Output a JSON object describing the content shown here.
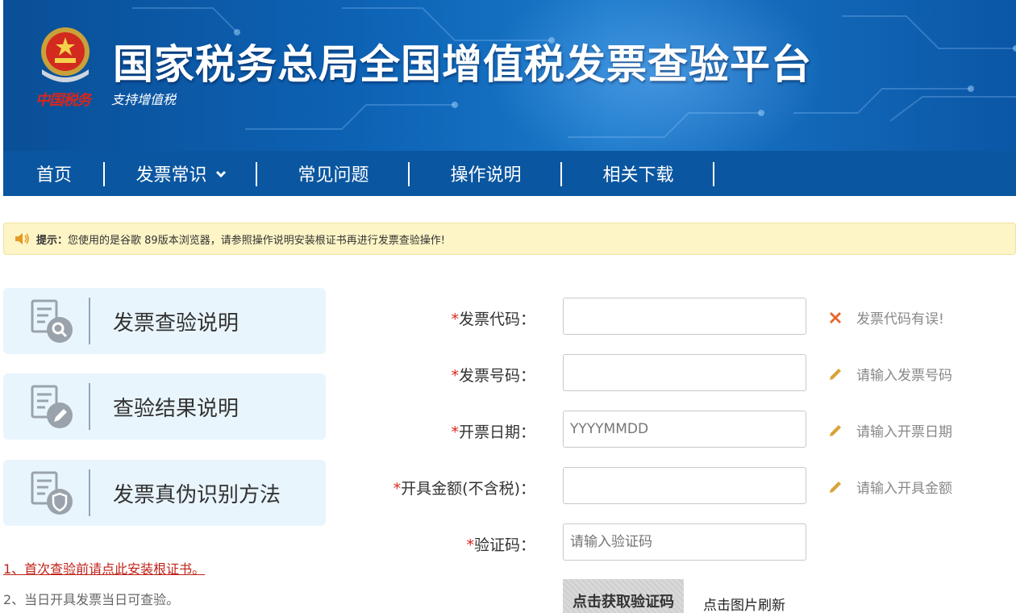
{
  "header": {
    "title": "国家税务总局全国增值税发票查验平台",
    "subtitle": "支持增值税",
    "brand_sign": "中国税务"
  },
  "nav": {
    "items": [
      {
        "label": "首页"
      },
      {
        "label": "发票常识",
        "dropdown": true
      },
      {
        "label": "常见问题"
      },
      {
        "label": "操作说明"
      },
      {
        "label": "相关下载"
      }
    ]
  },
  "tip": {
    "label": "提示：",
    "text": "您使用的是谷歌 89版本浏览器，请参照操作说明安装根证书再进行发票查验操作!"
  },
  "side_cards": [
    {
      "label": "发票查验说明",
      "icon": "doc-search-icon"
    },
    {
      "label": "查验结果说明",
      "icon": "doc-edit-icon"
    },
    {
      "label": "发票真伪识别方法",
      "icon": "doc-shield-icon"
    }
  ],
  "notes": [
    {
      "text": "1、首次查验前请点此安装根证书。"
    },
    {
      "text": "2、当日开具发票当日可查验。"
    }
  ],
  "form": {
    "required_mark": "*",
    "fields": [
      {
        "label": "发票代码：",
        "value": "",
        "placeholder": "",
        "hint": "发票代码有误!",
        "hint_icon": "error-x-icon"
      },
      {
        "label": "发票号码：",
        "value": "",
        "placeholder": "",
        "hint": "请输入发票号码",
        "hint_icon": "pencil-icon"
      },
      {
        "label": "开票日期：",
        "value": "",
        "placeholder": "YYYYMMDD",
        "hint": "请输入开票日期",
        "hint_icon": "pencil-icon"
      },
      {
        "label": "开具金额(不含税)：",
        "value": "",
        "placeholder": "",
        "hint": "请输入开具金额",
        "hint_icon": "pencil-icon"
      },
      {
        "label": "验证码：",
        "value": "",
        "placeholder": "请输入验证码"
      }
    ],
    "captcha_text": "点击获取验证码",
    "captcha_hint": "点击图片刷新"
  },
  "colors": {
    "nav_bg": "#0a56a0",
    "banner_blue": "#0d62b4",
    "tip_bg": "#fdf5c6",
    "card_bg": "#e9f5fd",
    "required_red": "#d9261c",
    "error_orange": "#e8652c",
    "pencil_orange": "#d9a23a"
  }
}
